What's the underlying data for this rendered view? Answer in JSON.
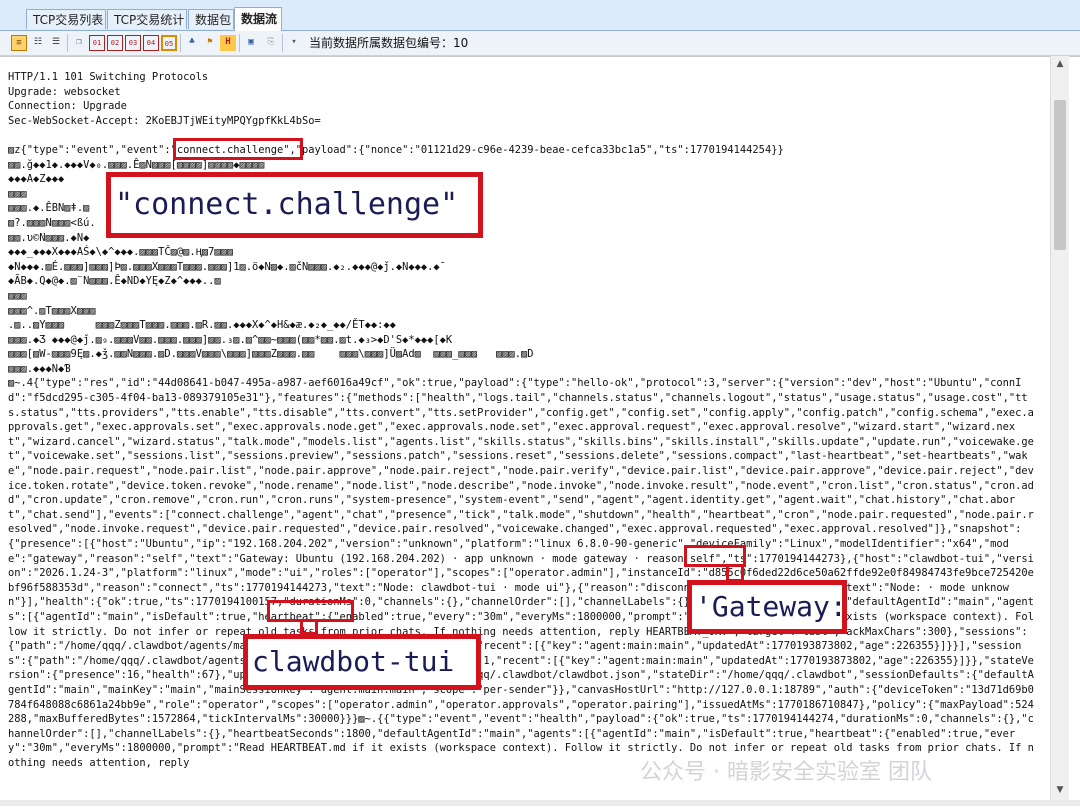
{
  "tabs": [
    "TCP交易列表",
    "TCP交易统计",
    "数据包",
    "数据流"
  ],
  "toolbar": {
    "packet_label": "当前数据所属数据包编号：",
    "packet_number": "10"
  },
  "stream_text": "HTTP/1.1 101 Switching Protocols\nUpgrade: websocket\nConnection: Upgrade\nSec-WebSocket-Accept: 2KoEBJTjWEityMPQYgpfKkL4bSo=\n\n▨z{\"type\":\"event\",\"event\":\"connect.challenge\",\"payload\":{\"nonce\":\"01121d29-c96e-4239-beae-cefca33bc1a5\",\"ts\":1770194144254}}\n▨▨.ğ◆◆1◆.◆◆◆V◆₀.▨▨▨.Ê▨N▨▨▨[▨▨▨▨]▨▨▨▨◆▨▨▨▨\n◆◆◆A◆Z◆◆◆\n▨▨▨\n▨▨▨.◆.ÊBN▨ǂ.▨\n▨?.▨▨▨N▨▨▨<ßú.\n▨▨.υ©N▨▨▨.◆N◆\n◆◆◆_◆◆◆X◆◆◆AŚ◆\\◆^◆◆◆.▨▨▨TČ▨@▨.Ⱨ▨7▨▨▨\n◆N◆◆◆.▨É.▨▨▨]▨▨▨]Þ▨.▨▨▨X▨▨▨T▨▨▨.▨▨▨]1▨.ö◆N▨◆.▨čN▨▨▨.◆₂.◆◆◆@◆ǰ.◆N◆◆◆.◆¯\n◆ÃB◆.Q◆@◆.▨¨N▨▨▨.Ê◆ND◆YĘ◆Z◆^◆◆◆..▨\n▨▨▨\n▨▨▨^.▨T▨▨▨X▨▨▨\n.▨..▨Y▨▨▨     ▨▨▨Z▨▨▨T▨▨▨.▨▨▨.▨R.▨▨.◆◆◆X◆^◆H&◆æ.◆₂◆_◆◆/ĚT◆◆:◆◆\n▨▨▨.◆Ʒ ◆◆◆@◆ǰ.▨₉.▨▨▨V▨▨.▨▨▨.▨▨▨]▨▨.₃▨.▨^▨▨~▨▨▨(▨▨*▨▨.▨t.◆₃>◆D'S◆*◆◆◆[◆K\n▨▨▨[▨W-▨▨▨9Ę▨.◆ǯ.▨▨N▨▨▨.▨D.▨▨▨V▨▨▨\\▨▨▨]▨▨▨Z▨▨▨.▨▨    ▨▨▨\\▨▨▨]Ü▨Ad▨  ▨▨▨_▨▨▨   ▨▨▨.▨D\n▨▨▨.◆◆◆N◆Ɓ\n▨~.4{\"type\":\"res\",\"id\":\"44d08641-b047-495a-a987-aef6016a49cf\",\"ok\":true,\"payload\":{\"type\":\"hello-ok\",\"protocol\":3,\"server\":{\"version\":\"dev\",\"host\":\"Ubuntu\",\"connId\":\"f5dcd295-c305-4f04-ba13-089379105e31\"},\"features\":{\"methods\":[\"health\",\"logs.tail\",\"channels.status\",\"channels.logout\",\"status\",\"usage.status\",\"usage.cost\",\"tts.status\",\"tts.providers\",\"tts.enable\",\"tts.disable\",\"tts.convert\",\"tts.setProvider\",\"config.get\",\"config.set\",\"config.apply\",\"config.patch\",\"config.schema\",\"exec.approvals.get\",\"exec.approvals.set\",\"exec.approvals.node.get\",\"exec.approvals.node.set\",\"exec.approval.request\",\"exec.approval.resolve\",\"wizard.start\",\"wizard.next\",\"wizard.cancel\",\"wizard.status\",\"talk.mode\",\"models.list\",\"agents.list\",\"skills.status\",\"skills.bins\",\"skills.install\",\"skills.update\",\"update.run\",\"voicewake.get\",\"voicewake.set\",\"sessions.list\",\"sessions.preview\",\"sessions.patch\",\"sessions.reset\",\"sessions.delete\",\"sessions.compact\",\"last-heartbeat\",\"set-heartbeats\",\"wake\",\"node.pair.request\",\"node.pair.list\",\"node.pair.approve\",\"node.pair.reject\",\"node.pair.verify\",\"device.pair.list\",\"device.pair.approve\",\"device.pair.reject\",\"device.token.rotate\",\"device.token.revoke\",\"node.rename\",\"node.list\",\"node.describe\",\"node.invoke\",\"node.invoke.result\",\"node.event\",\"cron.list\",\"cron.status\",\"cron.add\",\"cron.update\",\"cron.remove\",\"cron.run\",\"cron.runs\",\"system-presence\",\"system-event\",\"send\",\"agent\",\"agent.identity.get\",\"agent.wait\",\"chat.history\",\"chat.abort\",\"chat.send\"],\"events\":[\"connect.challenge\",\"agent\",\"chat\",\"presence\",\"tick\",\"talk.mode\",\"shutdown\",\"health\",\"heartbeat\",\"cron\",\"node.pair.requested\",\"node.pair.resolved\",\"node.invoke.request\",\"device.pair.requested\",\"device.pair.resolved\",\"voicewake.changed\",\"exec.approval.requested\",\"exec.approval.resolved\"]},\"snapshot\":{\"presence\":[{\"host\":\"Ubuntu\",\"ip\":\"192.168.204.202\",\"version\":\"unknown\",\"platform\":\"linux 6.8.0-90-generic\",\"deviceFamily\":\"Linux\",\"modelIdentifier\":\"x64\",\"mode\":\"gateway\",\"reason\":\"self\",\"text\":\"Gateway: Ubuntu (192.168.204.202) · app unknown · mode gateway · reason self\",\"ts\":1770194144273},{\"host\":\"clawdbot-tui\",\"version\":\"2026.1.24-3\",\"platform\":\"linux\",\"mode\":\"ui\",\"roles\":[\"operator\"],\"scopes\":[\"operator.admin\"],\"instanceId\":\"d855c0f6ded22d6ce50a62ffde92e0f84984743fe9bce725420ebf96f588353d\",\"reason\":\"connect\",\"ts\":1770194144273,\"text\":\"Node: clawdbot-tui · mode ui\"},{\"reason\":\"disconnect\",\"ts\":1770194100157,\"text\":\"Node: · mode unknown\"}],\"health\":{\"ok\":true,\"ts\":1770194100157,\"durationMs\":0,\"channels\":{},\"channelOrder\":[],\"channelLabels\":{},\"heartbeatSeconds\":1800,\"defaultAgentId\":\"main\",\"agents\":[{\"agentId\":\"main\",\"isDefault\":true,\"heartbeat\":{\"enabled\":true,\"every\":\"30m\",\"everyMs\":1800000,\"prompt\":\"Read HEARTBEAT.md if it exists (workspace context). Follow it strictly. Do not infer or repeat old tasks from prior chats. If nothing needs attention, reply HEARTBEAT_OK.\",\"target\":\"last\",\"ackMaxChars\":300},\"sessions\":{\"path\":\"/home/qqq/.clawdbot/agents/main/sessions/sessions.json\",\"count\":1,\"recent\":[{\"key\":\"agent:main:main\",\"updatedAt\":1770193873802,\"age\":226355}]}}],\"sessions\":{\"path\":\"/home/qqq/.clawdbot/agents/main/sessions/sessions.json\",\"count\":1,\"recent\":[{\"key\":\"agent:main:main\",\"updatedAt\":1770193873802,\"age\":226355}]}},\"stateVersion\":{\"presence\":16,\"health\":67},\"uptimeMs\":3304841,\"configPath\":\"/home/qqq/.clawdbot/clawdbot.json\",\"stateDir\":\"/home/qqq/.clawdbot\",\"sessionDefaults\":{\"defaultAgentId\":\"main\",\"mainKey\":\"main\",\"mainSessionKey\":\"agent:main:main\",\"scope\":\"per-sender\"}},\"canvasHostUrl\":\"http://127.0.0.1:18789\",\"auth\":{\"deviceToken\":\"13d71d69b0784f648088c6861a24bb9e\",\"role\":\"operator\",\"scopes\":[\"operator.admin\",\"operator.approvals\",\"operator.pairing\"],\"issuedAtMs\":1770186710847},\"policy\":{\"maxPayload\":524288,\"maxBufferedBytes\":1572864,\"tickIntervalMs\":30000}}}▨~.{{\"type\":\"event\",\"event\":\"health\",\"payload\":{\"ok\":true,\"ts\":1770194144274,\"durationMs\":0,\"channels\":{},\"channelOrder\":[],\"channelLabels\":{},\"heartbeatSeconds\":1800,\"defaultAgentId\":\"main\",\"agents\":[{\"agentId\":\"main\",\"isDefault\":true,\"heartbeat\":{\"enabled\":true,\"every\":\"30m\",\"everyMs\":1800000,\"prompt\":\"Read HEARTBEAT.md if it exists (workspace context). Follow it strictly. Do not infer or repeat old tasks from prior chats. If nothing needs attention, reply",
  "callouts": {
    "connect": "\"connect.challenge\"",
    "gateway": "'Gateway:",
    "clawdbot": "clawdbot-tui"
  },
  "watermark": "公众号 · 暗影安全实验室 团队"
}
